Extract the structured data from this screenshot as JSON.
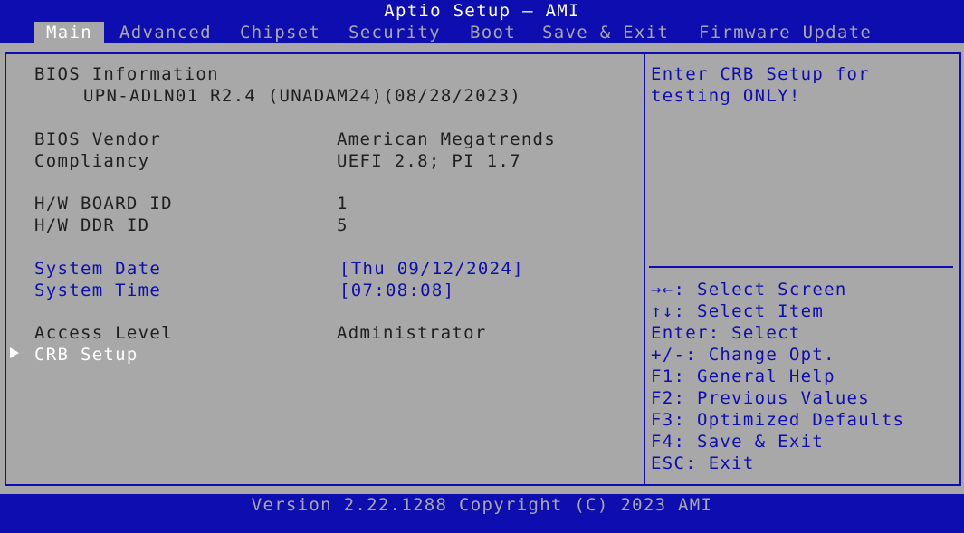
{
  "header": {
    "title": "Aptio Setup – AMI"
  },
  "tabs": [
    "Main",
    "Advanced",
    "Chipset",
    "Security",
    "Boot",
    "Save & Exit",
    "Firmware Update"
  ],
  "main": {
    "bios_info_label": "BIOS Information",
    "bios_info_value": "UPN-ADLN01 R2.4 (UNADAM24)(08/28/2023)",
    "bios_vendor_label": "BIOS Vendor",
    "bios_vendor_value": "American Megatrends",
    "compliancy_label": "Compliancy",
    "compliancy_value": "UEFI 2.8; PI 1.7",
    "hw_board_id_label": "H/W BOARD ID",
    "hw_board_id_value": "1",
    "hw_ddr_id_label": "H/W DDR ID",
    "hw_ddr_id_value": "5",
    "system_date_label": "System Date",
    "system_date_value": "[Thu 09/12/2024]",
    "system_time_label": "System Time",
    "system_time_value": "[07:08:08]",
    "access_level_label": "Access Level",
    "access_level_value": "Administrator",
    "crb_setup_label": "CRB Setup"
  },
  "help": {
    "line1": "Enter CRB Setup for",
    "line2": "testing ONLY!"
  },
  "keys": [
    "→←: Select Screen",
    "↑↓: Select Item",
    "Enter: Select",
    "+/-: Change Opt.",
    "F1: General Help",
    "F2: Previous Values",
    "F3: Optimized Defaults",
    "F4: Save & Exit",
    "ESC: Exit"
  ],
  "footer": {
    "text": "Version 2.22.1288 Copyright (C) 2023 AMI"
  },
  "colors": {
    "background": "#0d0db0",
    "panel": "#a8a8a8",
    "accent_text": "#0d0db0",
    "selected": "#ffffff",
    "label": "#202020"
  }
}
